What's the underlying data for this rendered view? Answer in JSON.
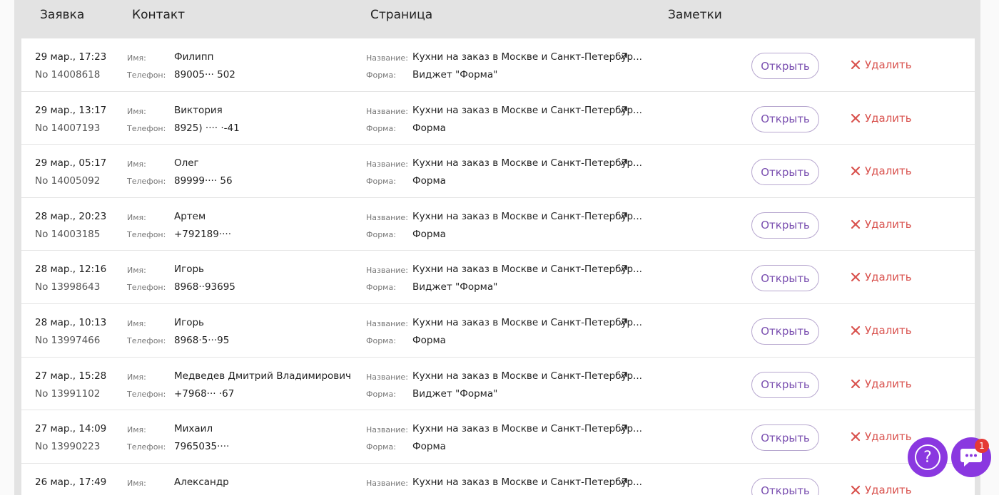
{
  "header": {
    "col_request": "Заявка",
    "col_contact": "Контакт",
    "col_page": "Страница",
    "col_notes": "Заметки"
  },
  "labels": {
    "name": "Имя:",
    "phone": "Телефон:",
    "page_name": "Название:",
    "form": "Форма:",
    "open": "Открыть",
    "delete": "Удалить"
  },
  "rows": [
    {
      "date": "29 мар., 17:23",
      "number": "No 14008618",
      "name": "Филипп",
      "phone": "89005··· 502",
      "page": "Кухни на заказ в Москве и Санкт-Петербур...",
      "form": "Виджет \"Форма\""
    },
    {
      "date": "29 мар., 13:17",
      "number": "No 14007193",
      "name": "Виктория",
      "phone": "8925) ···· ·-41",
      "page": "Кухни на заказ в Москве и Санкт-Петербур...",
      "form": "Форма"
    },
    {
      "date": "29 мар., 05:17",
      "number": "No 14005092",
      "name": "Олег",
      "phone": "89999···· 56",
      "page": "Кухни на заказ в Москве и Санкт-Петербур...",
      "form": "Форма"
    },
    {
      "date": "28 мар., 20:23",
      "number": "No 14003185",
      "name": "Артем",
      "phone": "+792189···· ",
      "page": "Кухни на заказ в Москве и Санкт-Петербур...",
      "form": "Форма"
    },
    {
      "date": "28 мар., 12:16",
      "number": "No 13998643",
      "name": "Игорь",
      "phone": "8968··93695",
      "page": "Кухни на заказ в Москве и Санкт-Петербур...",
      "form": "Виджет \"Форма\""
    },
    {
      "date": "28 мар., 10:13",
      "number": "No 13997466",
      "name": "Игорь",
      "phone": "8968·5···95",
      "page": "Кухни на заказ в Москве и Санкт-Петербур...",
      "form": "Форма"
    },
    {
      "date": "27 мар., 15:28",
      "number": "No 13991102",
      "name": "Медведев Дмитрий Владимирович",
      "phone": "+7968··· ·67",
      "page": "Кухни на заказ в Москве и Санкт-Петербур...",
      "form": "Виджет \"Форма\""
    },
    {
      "date": "27 мар., 14:09",
      "number": "No 13990223",
      "name": "Михаил",
      "phone": "7965035···· ",
      "page": "Кухни на заказ в Москве и Санкт-Петербур...",
      "form": "Форма"
    },
    {
      "date": "26 мар., 17:49",
      "number": "",
      "name": "Александр",
      "phone": "",
      "page": "Кухни на заказ в Москве и Санкт-Петербур...",
      "form": ""
    }
  ],
  "widgets": {
    "help_symbol": "?",
    "chat_badge": "1",
    "help_icon": "question-icon",
    "chat_icon": "chat-bubble-icon"
  },
  "colors": {
    "accent": "#8a38e0",
    "open_text": "#7a4fb0",
    "delete_text": "#d9534f",
    "badge": "#e53935"
  }
}
